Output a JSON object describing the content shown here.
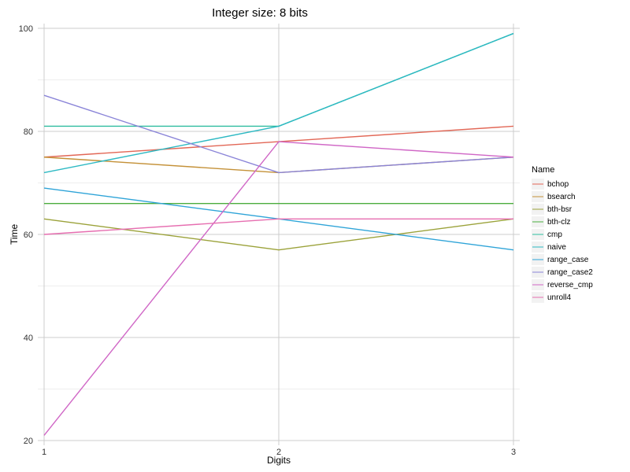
{
  "chart_data": {
    "type": "line",
    "title": "Integer size: 8 bits",
    "xlabel": "Digits",
    "ylabel": "Time",
    "legend_title": "Name",
    "categories": [
      "1",
      "2",
      "3"
    ],
    "x": [
      1,
      2,
      3
    ],
    "xlim": [
      1,
      3
    ],
    "ylim": [
      20,
      100
    ],
    "y_ticks": [
      20,
      40,
      60,
      80,
      100
    ],
    "y_minor": [
      30,
      50,
      70,
      90
    ],
    "grid": true,
    "legend_position": "right",
    "series": [
      {
        "name": "bchop",
        "color": "#e26756",
        "values": [
          75,
          78,
          81
        ]
      },
      {
        "name": "bsearch",
        "color": "#c49138",
        "values": [
          75,
          72,
          75
        ]
      },
      {
        "name": "bth-bsr",
        "color": "#9ba23a",
        "values": [
          63,
          57,
          63
        ]
      },
      {
        "name": "bth-clz",
        "color": "#4bad3e",
        "values": [
          66,
          66,
          66
        ]
      },
      {
        "name": "cmp",
        "color": "#2fbda0",
        "values": [
          81,
          81,
          99
        ]
      },
      {
        "name": "naive",
        "color": "#2db9c3",
        "values": [
          72,
          81,
          99
        ]
      },
      {
        "name": "range_case",
        "color": "#2fa4d8",
        "values": [
          69,
          63,
          57
        ]
      },
      {
        "name": "range_case2",
        "color": "#8a84d8",
        "values": [
          87,
          72,
          75
        ]
      },
      {
        "name": "reverse_cmp",
        "color": "#d067c6",
        "values": [
          21,
          78,
          75
        ]
      },
      {
        "name": "unroll4",
        "color": "#e66eb0",
        "values": [
          60,
          63,
          63
        ]
      }
    ]
  }
}
